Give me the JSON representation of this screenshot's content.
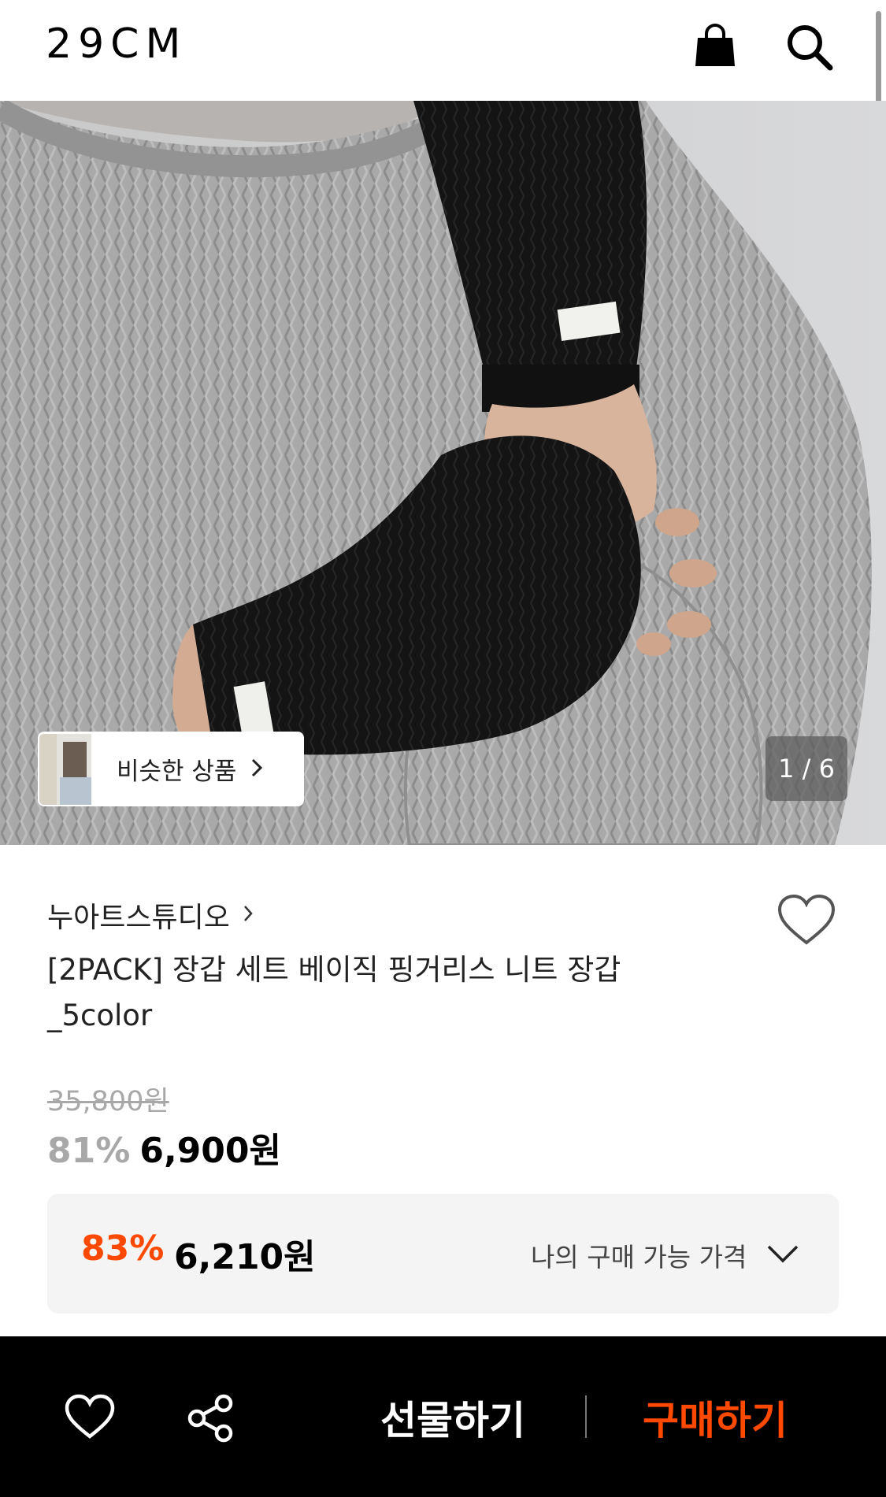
{
  "header": {
    "logo": "29CM",
    "icons": [
      "shopping-bag-icon",
      "search-icon"
    ]
  },
  "gallery": {
    "similar_label": "비슷한 상품",
    "counter": "1 / 6"
  },
  "product": {
    "brand": "누아트스튜디오",
    "title": "[2PACK] 장갑 세트 베이직 핑거리스 니트 장갑 _5color",
    "original_price": "35,800원",
    "discount_rate": "81%",
    "sale_price": "6,900원"
  },
  "my_price": {
    "discount_rate": "83%",
    "price": "6,210원",
    "label": "나의 구매 가능 가격"
  },
  "bottom_bar": {
    "gift_label": "선물하기",
    "buy_label": "구매하기"
  },
  "colors": {
    "accent": "#ff4800",
    "bar_background": "#000000"
  }
}
